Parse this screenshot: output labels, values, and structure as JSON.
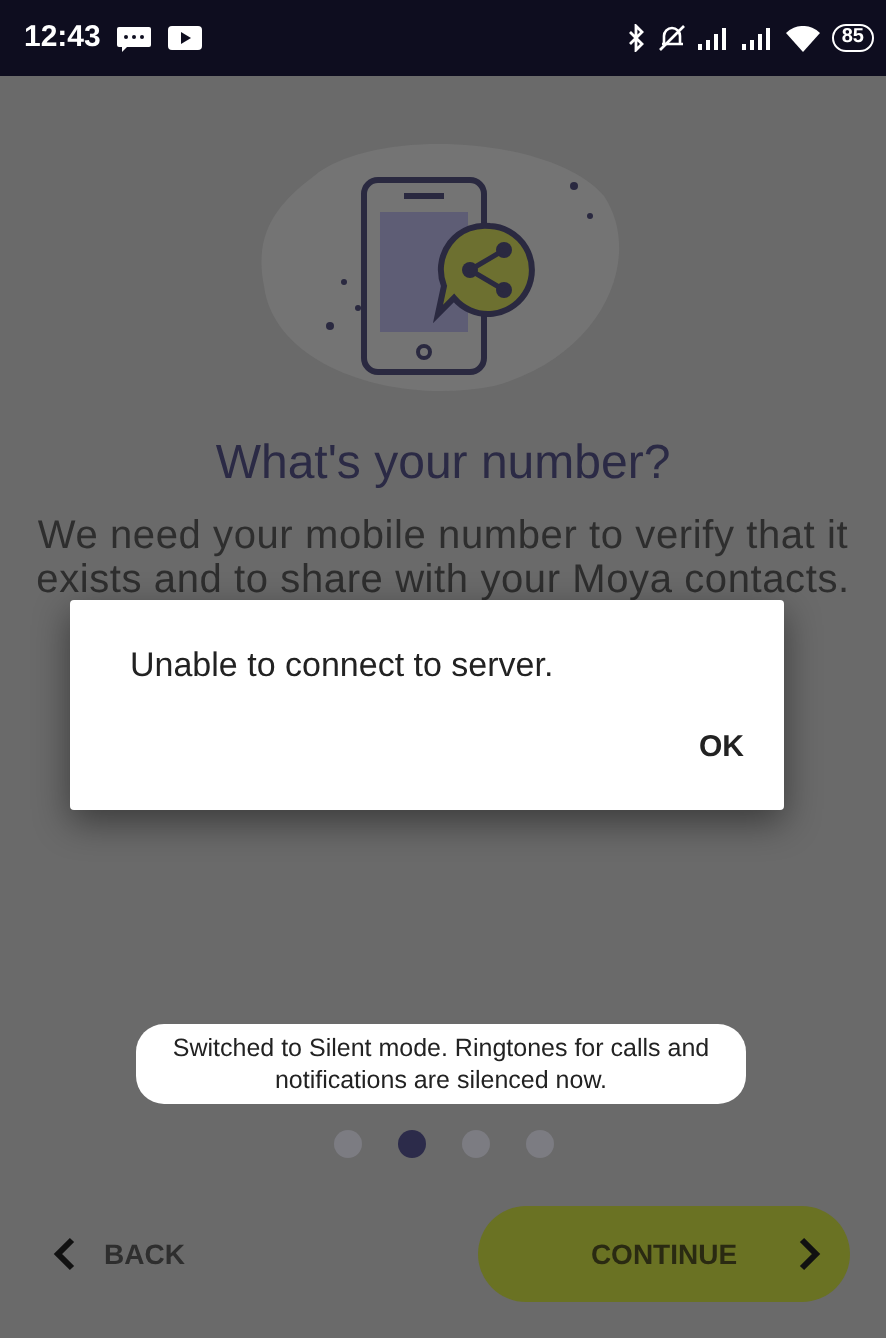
{
  "status_bar": {
    "time": "12:43",
    "battery": "85"
  },
  "onboarding": {
    "title": "What's your number?",
    "description": "We need your mobile number to verify that it exists and to share with your Moya contacts.",
    "pages": [
      {
        "selected": false
      },
      {
        "selected": true
      },
      {
        "selected": false
      },
      {
        "selected": false
      }
    ],
    "back_button": "BACK",
    "continue_button": "CONTINUE"
  },
  "dialog": {
    "message": "Unable to connect to server.",
    "ok_button": "OK"
  },
  "toast": {
    "message": "Switched to Silent mode. Ringtones for calls and notifications are silenced now."
  }
}
